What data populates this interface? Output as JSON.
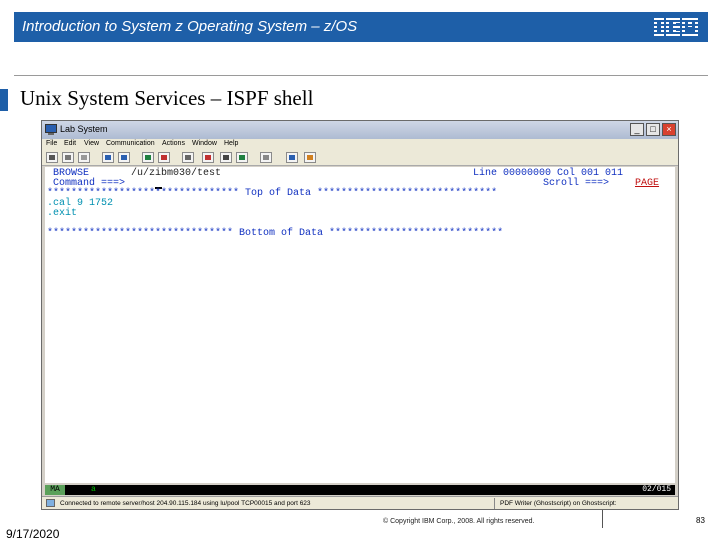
{
  "header": {
    "title": "Introduction to System z Operating System – z/OS",
    "logo": "IBM",
    "accent_color": "#1e5fa8"
  },
  "slide_title": "Unix System Services – ISPF shell",
  "window": {
    "title": "Lab System",
    "controls": {
      "minimize": "_",
      "maximize": "□",
      "close": "×"
    },
    "menu": [
      "File",
      "Edit",
      "View",
      "Communication",
      "Actions",
      "Window",
      "Help"
    ],
    "toolbar_icons": [
      "print-icon",
      "copy-icon",
      "paste-icon",
      "send-icon",
      "receive-icon",
      "display-icon",
      "color-icon",
      "settings-icon",
      "macro-icon",
      "record-icon",
      "play-icon",
      "keyboard-icon",
      "support-icon",
      "help-icon"
    ]
  },
  "terminal": {
    "mode": "BROWSE",
    "path": "/u/zibm030/test",
    "line_label": "Line 00000000 Col 001 011",
    "command_label": "Command ===>",
    "scroll_label": "Scroll ===>",
    "scroll_value": "PAGE",
    "top_marker": "******************************** Top of Data ******************************",
    "line1": ".cal 9 1752",
    "line2": ".exit",
    "bottom_marker": "******************************* Bottom of Data *****************************"
  },
  "oia": {
    "ma": "MA",
    "arrow": "a",
    "cursor_pos": "02/015"
  },
  "status": {
    "connection": "Connected to remote server/host 204.90.115.184 using lu/pool TCP00015 and port 623",
    "printer": "PDF Writer (Ghostscript) on Ghostscript:"
  },
  "footer": {
    "date": "9/17/2020",
    "copyright": "© Copyright IBM Corp., 2008. All rights reserved.",
    "page": "83"
  }
}
